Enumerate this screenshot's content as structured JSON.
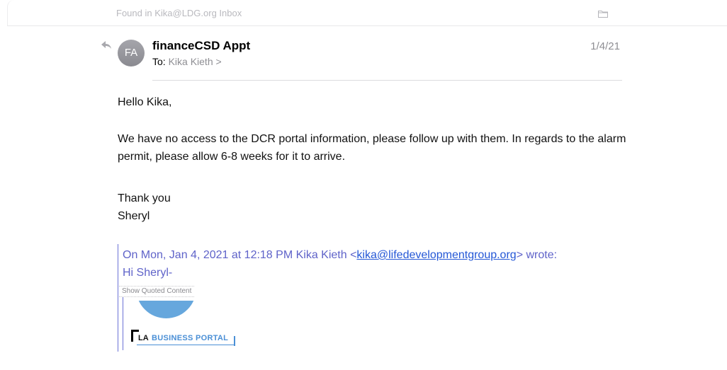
{
  "header": {
    "found_in": "Found in Kika@LDG.org Inbox",
    "folder_icon": "folder-icon"
  },
  "message": {
    "reply_icon": "reply-icon",
    "avatar_initials": "FA",
    "sender": "financeCSD Appt",
    "to_label": "To:",
    "recipient": "Kika Kieth >",
    "date": "1/4/21",
    "body": {
      "greeting": "Hello Kika,",
      "paragraph_1": " We have no access to the DCR portal information, please follow up with them. In regards to the alarm permit, please allow 6-8 weeks for it to arrive.",
      "thanks": "Thank you",
      "signature": "Sheryl"
    },
    "quoted": {
      "header_prefix": "On Mon, Jan 4, 2021 at 12:18 PM Kika Kieth <",
      "email": "kika@lifedevelopmentgroup.org",
      "header_suffix": "> wrote:",
      "greeting": "Hi Sheryl-",
      "show_quoted": "Show Quoted Content",
      "logo_la": "LA",
      "logo_text": "BUSINESS PORTAL"
    }
  },
  "colors": {
    "accent_link": "#2457d6",
    "quote_text": "#5f63c9",
    "logo_blue": "#4a8fd6"
  }
}
